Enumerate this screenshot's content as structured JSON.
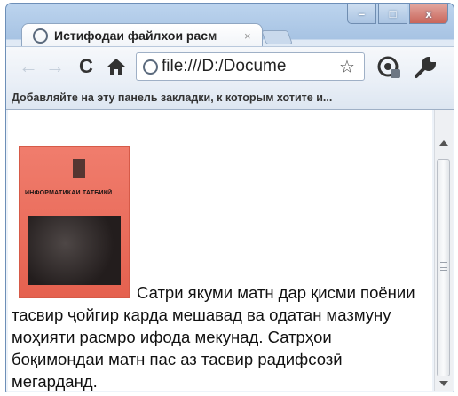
{
  "tab": {
    "title": "Истифодаи файлхои расм",
    "close": "×"
  },
  "window_controls": {
    "minimize": "–",
    "maximize": "□",
    "close": "x"
  },
  "toolbar": {
    "back": "←",
    "forward": "→",
    "reload": "C",
    "address": "file:///D:/Docume",
    "bookmark_star": "☆"
  },
  "bookmarks_bar": {
    "hint": "Добавляйте на эту панель закладки, к которым хотите и..."
  },
  "page": {
    "book_cover_title": "ИНФОРМАТИКАИ ТАТБИҚӢ",
    "paragraph": "Сатри якуми матн дар қисми поёнии тасвир ҷойгир карда мешавад ва одатан мазмуну моҳияти расмро ифода мекунад. Сатрҳои боқимондаи матн пас аз тасвир радифсозӣ мегарданд."
  },
  "colors": {
    "window_frame": "#a7c3e3",
    "book_cover": "#e5614f",
    "text": "#111111"
  },
  "icons": [
    "page-favicon-icon",
    "close-icon",
    "back-arrow-icon",
    "forward-arrow-icon",
    "reload-icon",
    "home-icon",
    "star-icon",
    "page-menu-icon",
    "wrench-icon"
  ]
}
